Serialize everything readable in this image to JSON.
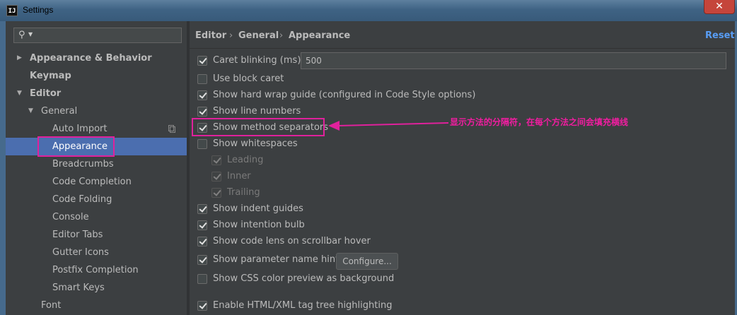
{
  "window": {
    "title": "Settings",
    "logo_text": "IJ",
    "close_glyph": "✕"
  },
  "search": {
    "value": "",
    "placeholder": ""
  },
  "tree": [
    {
      "label": "Appearance & Behavior",
      "arrow": "▶"
    },
    {
      "label": "Keymap"
    },
    {
      "label": "Editor",
      "arrow": "▼"
    },
    {
      "label": "General",
      "arrow": "▼"
    },
    {
      "label": "Auto Import"
    },
    {
      "label": "Appearance"
    },
    {
      "label": "Breadcrumbs"
    },
    {
      "label": "Code Completion"
    },
    {
      "label": "Code Folding"
    },
    {
      "label": "Console"
    },
    {
      "label": "Editor Tabs"
    },
    {
      "label": "Gutter Icons"
    },
    {
      "label": "Postfix Completion"
    },
    {
      "label": "Smart Keys"
    },
    {
      "label": "Font"
    }
  ],
  "breadcrumb": [
    "Editor",
    "General",
    "Appearance"
  ],
  "breadcrumb_sep": "›",
  "reset_label": "Reset",
  "options": [
    {
      "label": "Caret blinking (ms):",
      "checked": true,
      "enabled": true
    },
    {
      "label": "Use block caret",
      "checked": false,
      "enabled": true
    },
    {
      "label": "Show hard wrap guide (configured in Code Style options)",
      "checked": true,
      "enabled": true
    },
    {
      "label": "Show line numbers",
      "checked": true,
      "enabled": true
    },
    {
      "label": "Show method separators",
      "checked": true,
      "enabled": true
    },
    {
      "label": "Show whitespaces",
      "checked": false,
      "enabled": true
    },
    {
      "label": "Leading",
      "checked": true,
      "enabled": false
    },
    {
      "label": "Inner",
      "checked": true,
      "enabled": false
    },
    {
      "label": "Trailing",
      "checked": true,
      "enabled": false
    },
    {
      "label": "Show indent guides",
      "checked": true,
      "enabled": true
    },
    {
      "label": "Show intention bulb",
      "checked": true,
      "enabled": true
    },
    {
      "label": "Show code lens on scrollbar hover",
      "checked": true,
      "enabled": true
    },
    {
      "label": "Show parameter name hints",
      "checked": true,
      "enabled": true
    },
    {
      "label": "Show CSS color preview as background",
      "checked": false,
      "enabled": true
    },
    {
      "label": "Enable HTML/XML tag tree highlighting",
      "checked": true,
      "enabled": true
    }
  ],
  "caret_blink_value": "500",
  "configure_label": "Configure...",
  "annotation": {
    "text": "显示方法的分隔符，在每个方法之间会填充横线",
    "color": "#e0219c"
  },
  "colors": {
    "selection": "#4b6eaf",
    "accent_link": "#589df6",
    "background": "#3c3f41"
  }
}
